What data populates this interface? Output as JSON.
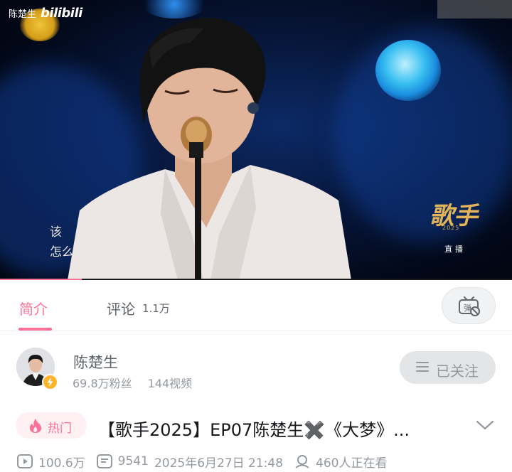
{
  "video": {
    "watermark_user": "陈楚生",
    "watermark_logo": "bilibili",
    "lyrics": [
      "该",
      "怎么办"
    ],
    "show_logo": "歌手",
    "show_year": "2025",
    "live_label": "直播",
    "progress_fraction": 0.16,
    "accent_color": "#fb7299"
  },
  "tabs": {
    "intro_label": "简介",
    "comments_label": "评论",
    "comments_count": "1.1万",
    "danmaku_icon": "danmaku-toggle-icon"
  },
  "uploader": {
    "name": "陈楚生",
    "fans": "69.8万粉丝",
    "videos": "144视频",
    "follow_label": "已关注",
    "follow_icon": "menu-icon"
  },
  "title_row": {
    "hot_label": "热门",
    "hot_icon": "flame-icon",
    "title": "【歌手2025】EP07陈楚生✖️《大梦》...",
    "expand_icon": "chevron-down-icon"
  },
  "stats": {
    "views": "100.6万",
    "danmaku_count": "9541",
    "datetime": "2025年6月27日 21:48",
    "watching": "460人正在看"
  }
}
